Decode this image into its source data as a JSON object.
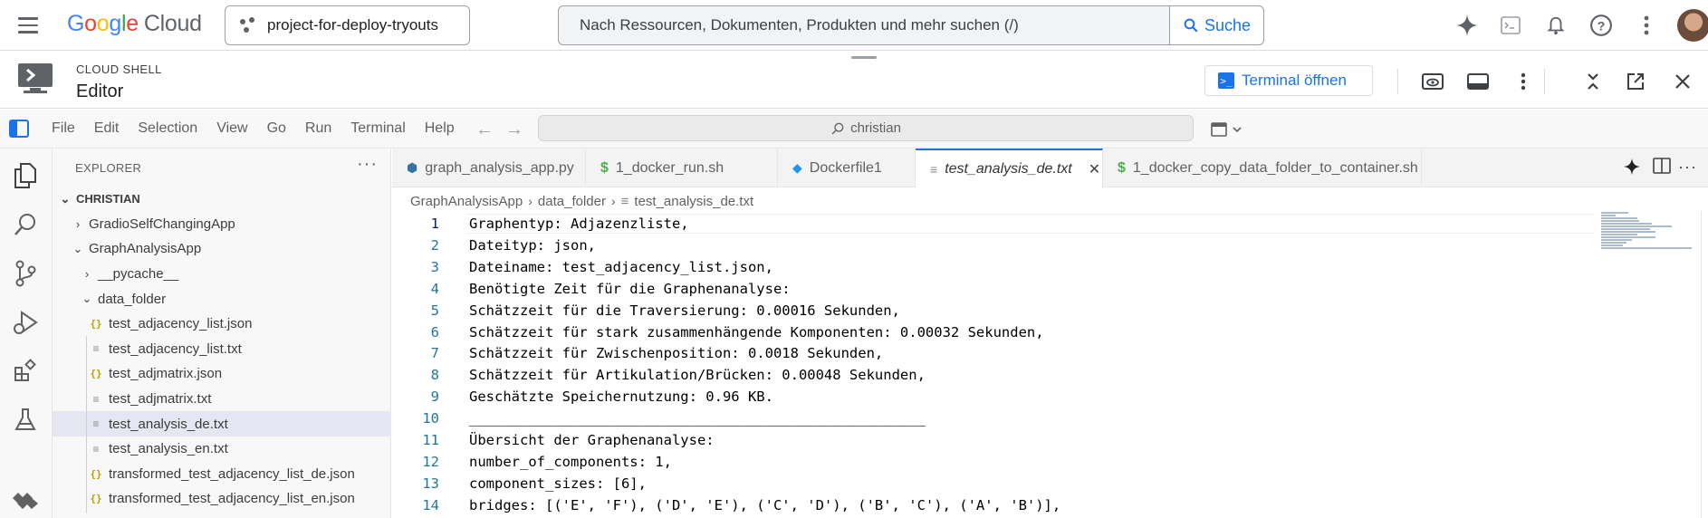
{
  "topbar": {
    "logo_google": [
      "G",
      "o",
      "o",
      "g",
      "l",
      "e"
    ],
    "logo_cloud": "Cloud",
    "project": "project-for-deploy-tryouts",
    "search_placeholder": "Nach Ressourcen, Dokumenten, Produkten und mehr suchen (/)",
    "search_button": "Suche",
    "icons": [
      "gemini-icon",
      "cloud-shell-icon",
      "notifications-icon",
      "help-icon",
      "more-icon",
      "avatar"
    ]
  },
  "cloud_shell": {
    "small_title": "CLOUD SHELL",
    "title": "Editor",
    "terminal_button": "Terminal öffnen"
  },
  "menubar": {
    "items": [
      "File",
      "Edit",
      "Selection",
      "View",
      "Go",
      "Run",
      "Terminal",
      "Help"
    ],
    "command_center": "christian"
  },
  "explorer": {
    "title": "EXPLORER",
    "tree": [
      {
        "label": "CHRISTIAN",
        "kind": "root"
      },
      {
        "label": "GradioSelfChangingApp",
        "kind": "folder-collapsed"
      },
      {
        "label": "GraphAnalysisApp",
        "kind": "folder-open"
      },
      {
        "label": "__pycache__",
        "kind": "folder-collapsed"
      },
      {
        "label": "data_folder",
        "kind": "folder-open"
      },
      {
        "label": "test_adjacency_list.json",
        "kind": "json"
      },
      {
        "label": "test_adjacency_list.txt",
        "kind": "txt"
      },
      {
        "label": "test_adjmatrix.json",
        "kind": "json"
      },
      {
        "label": "test_adjmatrix.txt",
        "kind": "txt"
      },
      {
        "label": "test_analysis_de.txt",
        "kind": "txt",
        "selected": true
      },
      {
        "label": "test_analysis_en.txt",
        "kind": "txt"
      },
      {
        "label": "transformed_test_adjacency_list_de.json",
        "kind": "json"
      },
      {
        "label": "transformed_test_adjacency_list_en.json",
        "kind": "json"
      }
    ]
  },
  "tabs": [
    {
      "label": "graph_analysis_app.py",
      "icon": "python-icon"
    },
    {
      "label": "1_docker_run.sh",
      "icon": "shell-icon"
    },
    {
      "label": "Dockerfile1",
      "icon": "docker-icon"
    },
    {
      "label": "test_analysis_de.txt",
      "icon": "text-file-icon",
      "active": true
    },
    {
      "label": "1_docker_copy_data_folder_to_container.sh",
      "icon": "shell-icon"
    }
  ],
  "breadcrumb": [
    "GraphAnalysisApp",
    "data_folder",
    "test_analysis_de.txt"
  ],
  "editor": {
    "active_line": 1,
    "lines": [
      {
        "n": "1",
        "text": "Graphentyp: Adjazenzliste,"
      },
      {
        "n": "2",
        "text": "Dateityp: json,"
      },
      {
        "n": "3",
        "text": "Dateiname: test_adjacency_list.json,"
      },
      {
        "n": "4",
        "text": "Benötigte Zeit für die Graphenanalyse:"
      },
      {
        "n": "5",
        "text": "Schätzzeit für die Traversierung: 0.00016 Sekunden,"
      },
      {
        "n": "6",
        "text": "Schätzzeit für stark zusammenhängende Komponenten: 0.00032 Sekunden,"
      },
      {
        "n": "7",
        "text": "Schätzzeit für Zwischenposition: 0.0018 Sekunden,"
      },
      {
        "n": "8",
        "text": "Schätzzeit für Artikulation/Brücken: 0.00048 Sekunden,"
      },
      {
        "n": "9",
        "text": "Geschätzte Speichernutzung: 0.96 KB."
      },
      {
        "n": "10",
        "text": "______________________________________________________"
      },
      {
        "n": "11",
        "text": "Übersicht der Graphenanalyse:"
      },
      {
        "n": "12",
        "text": "number_of_components: 1,"
      },
      {
        "n": "13",
        "text": "component_sizes: [6],"
      },
      {
        "n": "14",
        "text": "bridges: [('E', 'F'), ('D', 'E'), ('C', 'D'), ('B', 'C'), ('A', 'B')],"
      }
    ]
  }
}
